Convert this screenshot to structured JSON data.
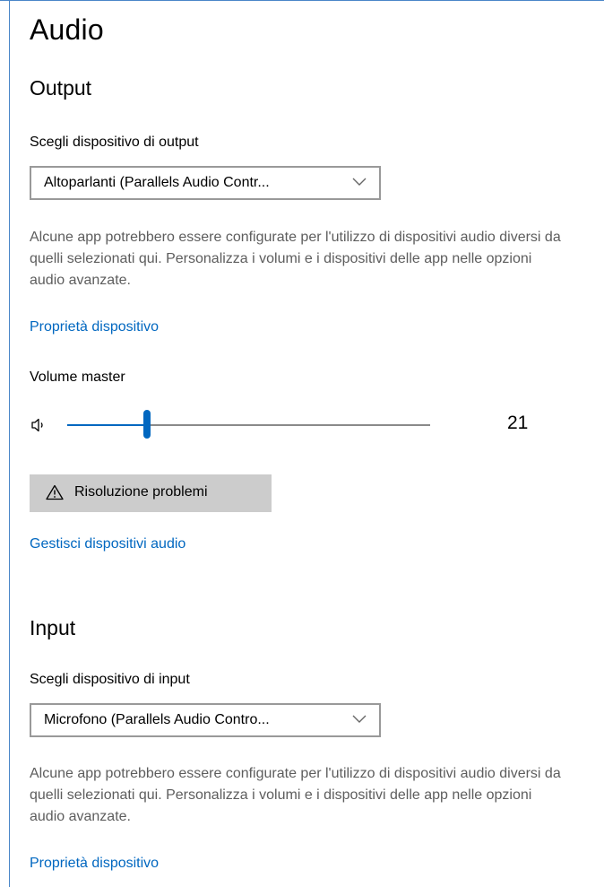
{
  "page": {
    "title": "Audio"
  },
  "output": {
    "heading": "Output",
    "device_label": "Scegli dispositivo di output",
    "device_value": "Altoparlanti (Parallels Audio Contr...",
    "description": "Alcune app potrebbero essere configurate per l'utilizzo di dispositivi audio diversi da quelli selezionati qui. Personalizza i volumi e i dispositivi delle app nelle opzioni audio avanzate.",
    "properties_link": "Proprietà dispositivo",
    "volume_label": "Volume master",
    "volume_value": "21",
    "volume_level": 21,
    "troubleshoot_label": "Risoluzione problemi",
    "manage_link": "Gestisci dispositivi audio"
  },
  "input": {
    "heading": "Input",
    "device_label": "Scegli dispositivo di input",
    "device_value": "Microfono (Parallels Audio Contro...",
    "description": "Alcune app potrebbero essere configurate per l'utilizzo di dispositivi audio diversi da quelli selezionati qui. Personalizza i volumi e i dispositivi delle app nelle opzioni audio avanzate.",
    "properties_link": "Proprietà dispositivo"
  },
  "icons": {
    "speaker": "speaker-icon",
    "warning": "warning-icon",
    "chevron": "chevron-down-icon"
  },
  "colors": {
    "accent": "#0067c0",
    "button_bg": "#cccccc",
    "secondary_text": "#5d5d5d"
  }
}
